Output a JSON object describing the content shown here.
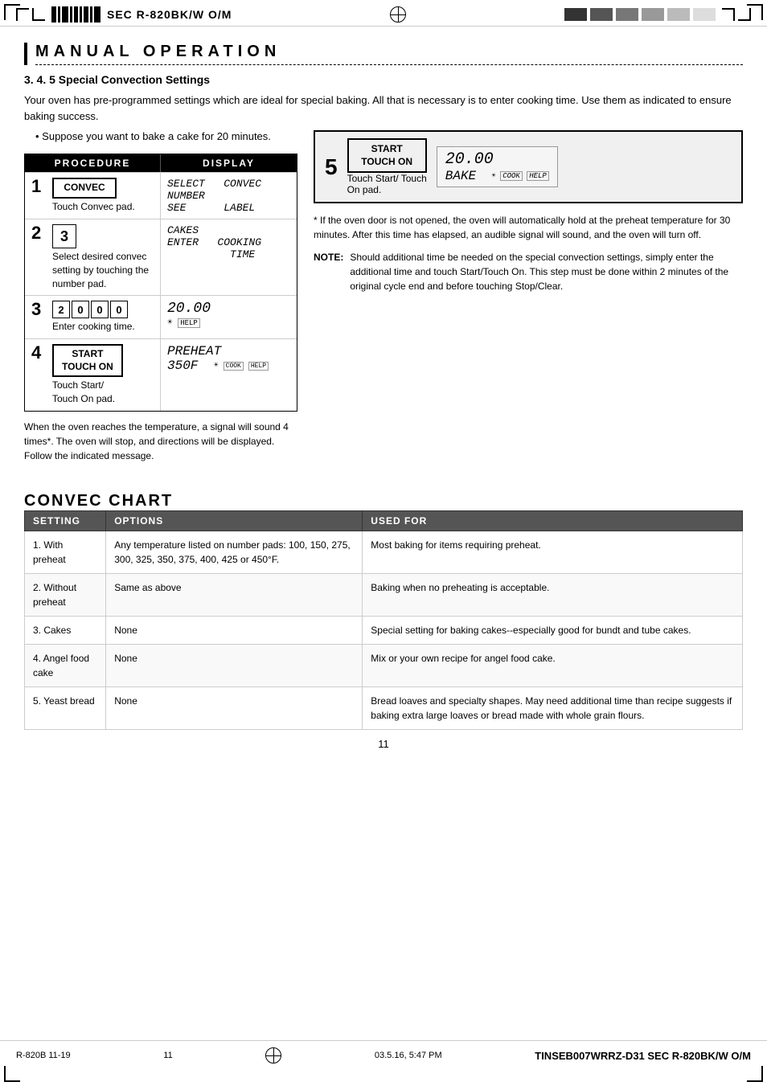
{
  "header": {
    "title": "SEC R-820BK/W O/M",
    "reg_marks": 2
  },
  "section": {
    "title": "MANUAL   OPERATION",
    "subsection": "3. 4. 5 Special Convection Settings",
    "intro1": "Your oven has  pre-programmed settings which are ideal for special baking. All that is necessary is to enter cooking time. Use them as indicated to ensure baking success.",
    "bullet": "Suppose you want to bake a cake for  20 minutes.",
    "procedure_header_left": "PROCEDURE",
    "procedure_header_right": "DISPLAY"
  },
  "steps": [
    {
      "num": "1",
      "button": "CONVEC",
      "label": "Touch Convec pad.",
      "display_lines": [
        "SELECT   CONVEC",
        "NUMBER",
        "SEE      LABEL"
      ]
    },
    {
      "num": "2",
      "button": "3",
      "label": "Select desired convec setting by touching the number pad.",
      "display_lines": [
        "CAKES",
        "ENTER   COOKING",
        "         TIME"
      ]
    },
    {
      "num": "3",
      "pads": [
        "2",
        "0",
        "0",
        "0"
      ],
      "label": "Enter cooking time.",
      "display_line1": "20.00",
      "display_icon": "🌀 HELP"
    },
    {
      "num": "4",
      "button_line1": "START",
      "button_line2": "TOUCH ON",
      "label1": "Touch Start/",
      "label2": "Touch On pad.",
      "display_line1": "PREHEAT",
      "display_line2": "350F",
      "display_icon": "🌀 COOK HELP"
    }
  ],
  "step5": {
    "num": "5",
    "button_line1": "START",
    "button_line2": "TOUCH ON",
    "label1": "Touch Start/ Touch",
    "label2": "On pad.",
    "display_time": "20.00",
    "display_bake": "BAKE",
    "display_icon": "COOK HELP"
  },
  "signal_text": "When the oven reaches the temperature, a signal will sound 4 times*. The oven will stop, and directions will be displayed. Follow the indicated message.",
  "note_asterisk": "If the oven door is not opened, the oven will automatically hold at the preheat temperature for 30 minutes. After this time has elapsed, an audible signal will sound, and the oven will turn off.",
  "note_label": "NOTE:",
  "note_text": "Should additional time be needed on the special convection settings, simply enter the additional time and touch Start/Touch On. This step must be done within 2 minutes of the original cycle end and before touching Stop/Clear.",
  "convec_chart": {
    "title": "CONVEC CHART",
    "headers": [
      "SETTING",
      "OPTIONS",
      "USED FOR"
    ],
    "rows": [
      {
        "setting": "1. With preheat",
        "options": "Any temperature listed on number pads: 100, 150, 275, 300, 325, 350, 375, 400, 425 or 450°F.",
        "used_for": "Most baking for items requiring preheat."
      },
      {
        "setting": "2. Without preheat",
        "options": "Same as above",
        "used_for": "Baking when no preheating is acceptable."
      },
      {
        "setting": "3. Cakes",
        "options": "None",
        "used_for": "Special setting for baking cakes--especially good for bundt and tube cakes."
      },
      {
        "setting": "4. Angel food cake",
        "options": "None",
        "used_for": "Mix or your own recipe for angel food cake."
      },
      {
        "setting": "5. Yeast bread",
        "options": "None",
        "used_for": "Bread loaves and specialty shapes. May need additional time than recipe suggests if baking extra large loaves or bread made with whole grain flours."
      }
    ]
  },
  "footer": {
    "left": "R-820B 11-19",
    "center_left": "11",
    "center_right": "03.5.16, 5:47 PM",
    "right": "TINSEB007WRRZ-D31 SEC R-820BK/W O/M"
  },
  "page_number": "11"
}
